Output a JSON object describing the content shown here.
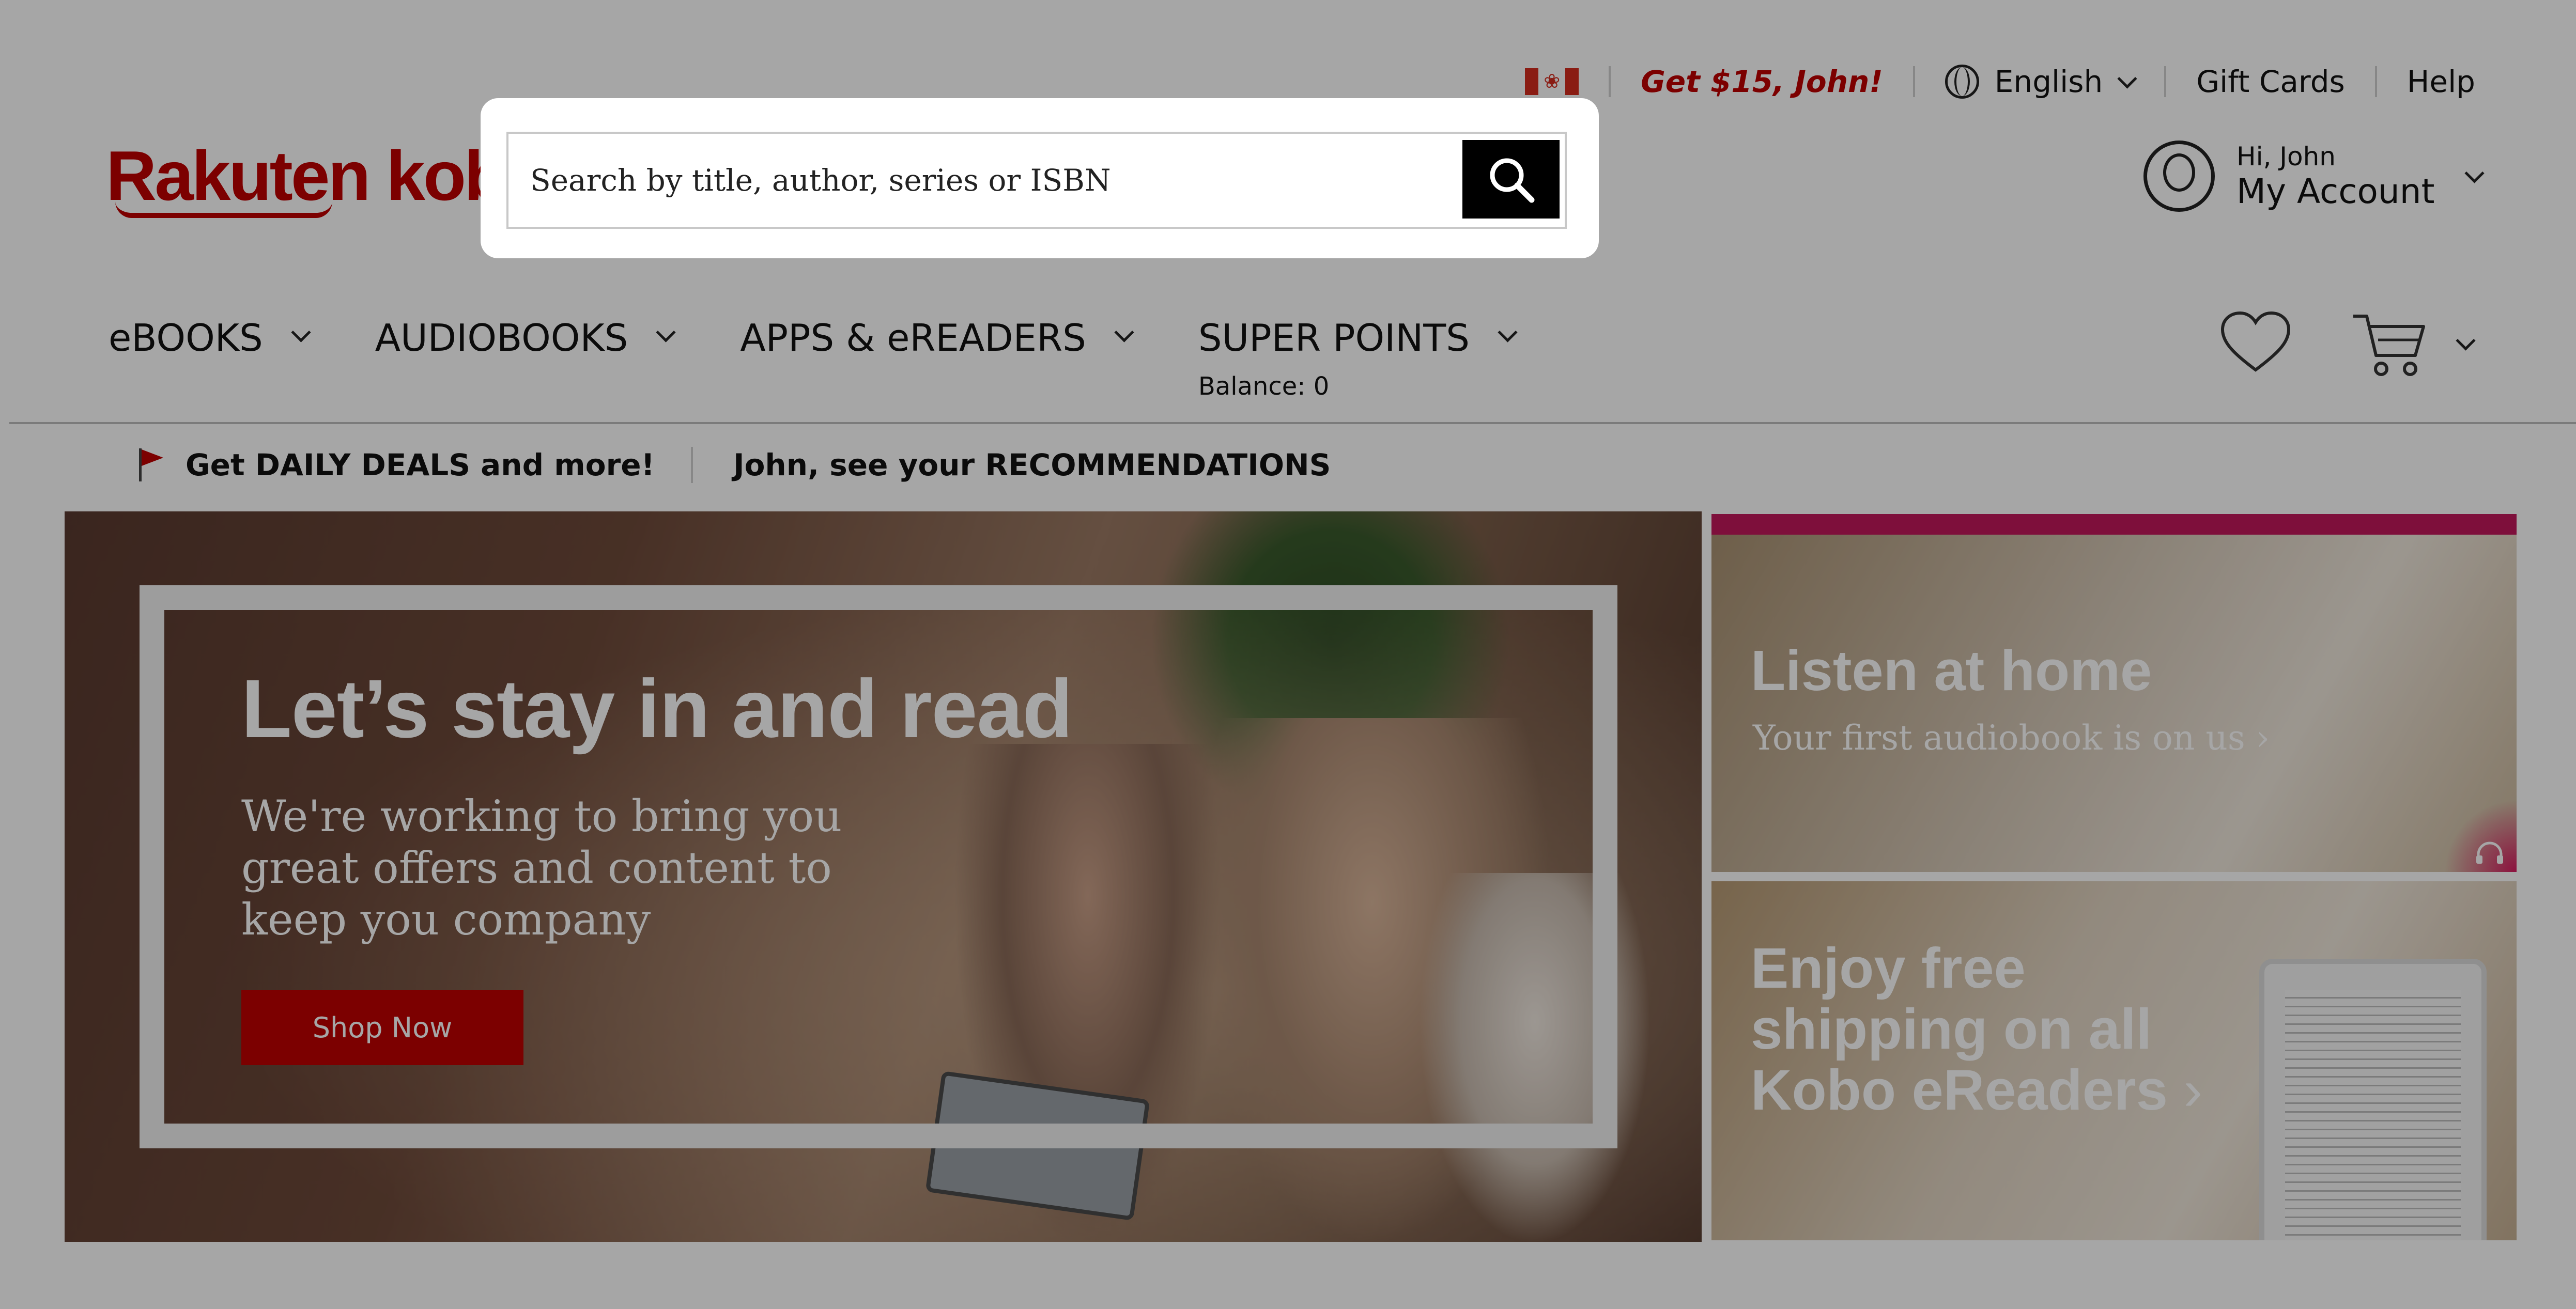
{
  "utility": {
    "country_flag": "flag-canada-icon",
    "promo": "Get $15, John!",
    "language": "English",
    "gift_cards": "Gift Cards",
    "help": "Help"
  },
  "logo": {
    "text": "Rakuten kobo"
  },
  "search": {
    "placeholder": "Search by title, author, series or ISBN",
    "value": "",
    "button_icon": "search-icon"
  },
  "account": {
    "greeting": "Hi, John",
    "label": "My Account"
  },
  "nav": {
    "items": [
      {
        "label": "eBOOKS"
      },
      {
        "label": "AUDIOBOOKS"
      },
      {
        "label": "APPS & eREADERS"
      },
      {
        "label": "SUPER POINTS",
        "sub": "Balance: 0"
      }
    ]
  },
  "deals_bar": {
    "deals": "Get DAILY DEALS and more!",
    "recommendations": "John, see your RECOMMENDATIONS"
  },
  "hero": {
    "title": "Let’s stay in and read",
    "subtitle": "We're working to bring you great offers and content to keep you company",
    "button": "Shop Now"
  },
  "side_banners": [
    {
      "title": "Listen at home",
      "subtitle": "Your first audiobook is on us",
      "arrow": "›"
    },
    {
      "title_lines": [
        "Enjoy free",
        "shipping on all",
        "Kobo eReaders"
      ],
      "arrow": "›"
    }
  ],
  "colors": {
    "brand": "#bf0000",
    "overlay": "rgba(0,0,0,0.35)"
  }
}
